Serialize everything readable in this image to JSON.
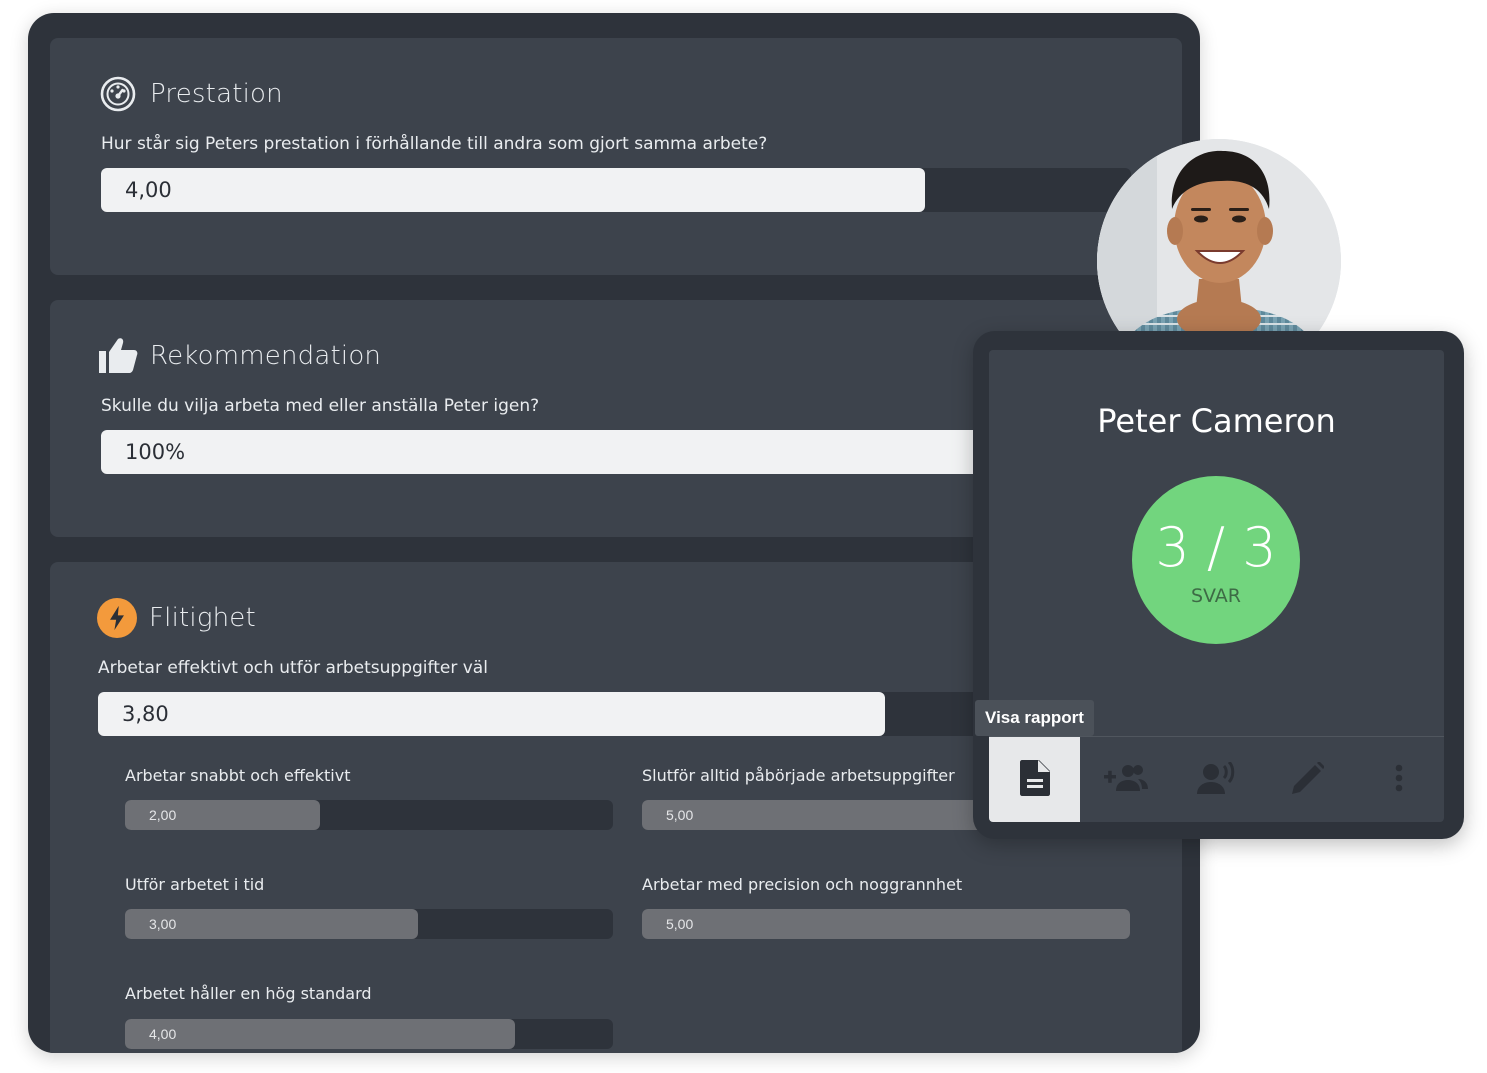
{
  "sections": {
    "prestation": {
      "title": "Prestation",
      "question": "Hur står sig Peters prestation i förhållande till andra som gjort samma arbete?",
      "value": "4,00",
      "fraction": 0.8
    },
    "rekommendation": {
      "title": "Rekommendation",
      "question": "Skulle du vilja arbeta med eller anställa Peter igen?",
      "value": "100%",
      "fraction": 1.0
    },
    "flitighet": {
      "title": "Flitighet",
      "question": "Arbetar effektivt och utför arbetsuppgifter väl",
      "value": "3,80",
      "fraction": 0.76,
      "items": [
        {
          "label": "Arbetar snabbt och effektivt",
          "value": "2,00",
          "fraction": 0.4
        },
        {
          "label": "Slutför alltid påbörjade arbetsuppgifter",
          "value": "5,00",
          "fraction": 1.0
        },
        {
          "label": "Utför arbetet i tid",
          "value": "3,00",
          "fraction": 0.6
        },
        {
          "label": "Arbetar med precision och noggrannhet",
          "value": "5,00",
          "fraction": 1.0
        },
        {
          "label": "Arbetet håller en hög standard",
          "value": "4,00",
          "fraction": 0.8
        }
      ]
    }
  },
  "profile": {
    "name": "Peter Cameron",
    "score": "3 / 3",
    "score_label": "SVAR",
    "tooltip": "Visa rapport",
    "toolbar": [
      "report-icon",
      "add-group-icon",
      "voice-icon",
      "edit-icon",
      "more-vert-icon"
    ]
  },
  "colors": {
    "frame": "#2e333b",
    "card": "#3d434c",
    "score_green": "#72d57e",
    "flitighet_orange": "#f39a3c"
  }
}
